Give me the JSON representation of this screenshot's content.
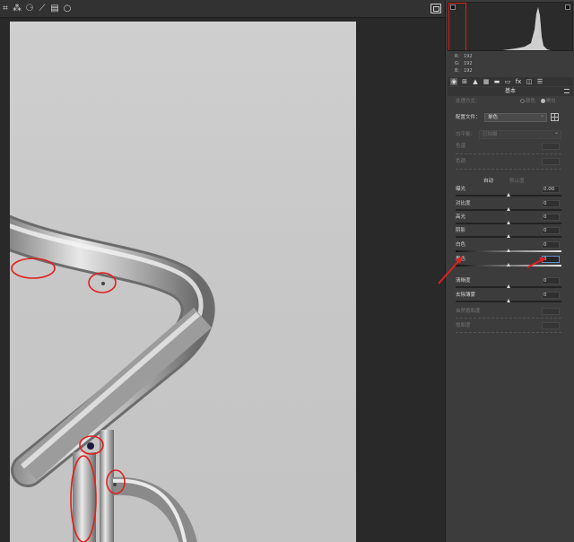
{
  "toolbar": {
    "tools": [
      {
        "icon": "crop-icon",
        "glyph": "⌗"
      },
      {
        "icon": "heal-icon",
        "glyph": "⁂"
      },
      {
        "icon": "redeye-icon",
        "glyph": "⚆"
      },
      {
        "icon": "brush-icon",
        "glyph": "⟋"
      },
      {
        "icon": "gradient-icon",
        "glyph": "▤"
      },
      {
        "icon": "radial-icon",
        "glyph": "○"
      }
    ],
    "fullscreen_icon": "fullscreen-icon"
  },
  "histogram": {
    "rgb": [
      {
        "label": "R:",
        "value": "192"
      },
      {
        "label": "G:",
        "value": "192"
      },
      {
        "label": "B:",
        "value": "192"
      }
    ]
  },
  "panel_tabs": [
    {
      "icon": "basic-icon",
      "glyph": "◉"
    },
    {
      "icon": "curve-icon",
      "glyph": "⊞"
    },
    {
      "icon": "detail-icon",
      "glyph": "▲"
    },
    {
      "icon": "hsl-icon",
      "glyph": "▦"
    },
    {
      "icon": "split-tone-icon",
      "glyph": "▬"
    },
    {
      "icon": "lens-icon",
      "glyph": "▭"
    },
    {
      "icon": "fx-icon",
      "glyph": "fx"
    },
    {
      "icon": "camera-calib-icon",
      "glyph": "◫"
    },
    {
      "icon": "presets-icon",
      "glyph": "☰"
    }
  ],
  "basic": {
    "title": "基本",
    "treatment_label": "处理方式：",
    "treatment_color": "颜色",
    "treatment_bw": "黑白",
    "profile_label": "配置文件：",
    "profile_value": "单色",
    "wb_label": "白平衡：",
    "wb_value": "已拍摄",
    "temp_label": "色温",
    "tint_label": "色调",
    "auto_label": "自动",
    "default_label": "默认值",
    "sliders": [
      {
        "label": "曝光",
        "value": "0.00",
        "position": 0.5,
        "enabled": true
      },
      {
        "label": "对比度",
        "value": "0",
        "position": 0.5,
        "enabled": true
      },
      {
        "label": "高光",
        "value": "0",
        "position": 0.5,
        "enabled": true
      },
      {
        "label": "阴影",
        "value": "0",
        "position": 0.5,
        "enabled": true
      },
      {
        "label": "白色",
        "value": "0",
        "position": 0.5,
        "enabled": true
      },
      {
        "label": "黑色",
        "value": "0",
        "position": 0.5,
        "enabled": true
      },
      {
        "label": "清晰度",
        "value": "0",
        "position": 0.5,
        "enabled": true
      },
      {
        "label": "去除薄雾",
        "value": "0",
        "position": 0.5,
        "enabled": true
      },
      {
        "label": "自然饱和度",
        "value": "",
        "position": 0.5,
        "enabled": false
      },
      {
        "label": "饱和度",
        "value": "",
        "position": 0.5,
        "enabled": false
      }
    ]
  },
  "annotation_color": "#e0201e"
}
